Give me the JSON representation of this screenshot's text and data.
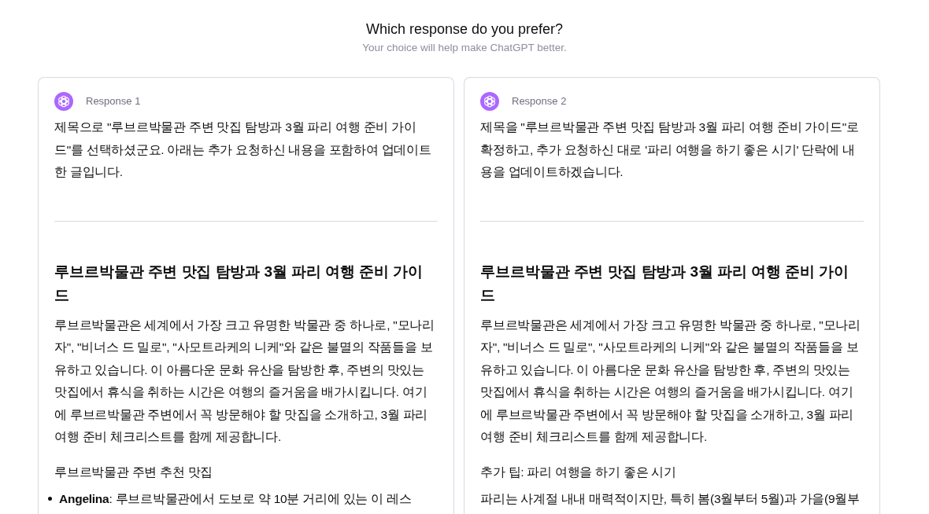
{
  "header": {
    "title": "Which response do you prefer?",
    "subtitle": "Your choice will help make ChatGPT better."
  },
  "responses": [
    {
      "label": "Response 1",
      "blocks": [
        {
          "kind": "paragraph",
          "text": "제목으로 \"루브르박물관 주변 맛집 탐방과 3월 파리 여행 준비 가이드\"를 선택하셨군요. 아래는 추가 요청하신 내용을 포함하여 업데이트한 글입니다."
        },
        {
          "kind": "rule"
        },
        {
          "kind": "heading",
          "text": "루브르박물관 주변 맛집 탐방과 3월 파리 여행 준비 가이드"
        },
        {
          "kind": "paragraph",
          "text": "루브르박물관은 세계에서 가장 크고 유명한 박물관 중 하나로, \"모나리자\", \"비너스 드 밀로\", \"사모트라케의 니케\"와 같은 불멸의 작품들을 보유하고 있습니다. 이 아름다운 문화 유산을 탐방한 후, 주변의 맛있는 맛집에서 휴식을 취하는 시간은 여행의 즐거움을 배가시킵니다. 여기에 루브르박물관 주변에서 꼭 방문해야 할 맛집을 소개하고, 3월 파리 여행 준비 체크리스트를 함께 제공합니다."
        },
        {
          "kind": "subheading",
          "text": "루브르박물관 주변 추천 맛집"
        },
        {
          "kind": "bullet",
          "text": "**Angelina**: 루브르박물관에서 도보로 약 10분 거리에 있는 이 레스"
        }
      ]
    },
    {
      "label": "Response 2",
      "blocks": [
        {
          "kind": "paragraph",
          "text": "제목을 \"루브르박물관 주변 맛집 탐방과 3월 파리 여행 준비 가이드\"로 확정하고, 추가 요청하신 대로 '파리 여행을 하기 좋은 시기' 단락에 내용을 업데이트하겠습니다."
        },
        {
          "kind": "rule"
        },
        {
          "kind": "heading",
          "text": "루브르박물관 주변 맛집 탐방과 3월 파리 여행 준비 가이드"
        },
        {
          "kind": "paragraph",
          "text": "루브르박물관은 세계에서 가장 크고 유명한 박물관 중 하나로, \"모나리자\", \"비너스 드 밀로\", \"사모트라케의 니케\"와 같은 불멸의 작품들을 보유하고 있습니다. 이 아름다운 문화 유산을 탐방한 후, 주변의 맛있는 맛집에서 휴식을 취하는 시간은 여행의 즐거움을 배가시킵니다. 여기에 루브르박물관 주변에서 꼭 방문해야 할 맛집을 소개하고, 3월 파리 여행 준비 체크리스트를 함께 제공합니다."
        },
        {
          "kind": "subheading",
          "text": "추가 팁: 파리 여행을 하기 좋은 시기"
        },
        {
          "kind": "paragraph",
          "text": "파리는 사계절 내내 매력적이지만, 특히 봄(3월부터 5월)과 가을(9월부"
        }
      ]
    }
  ]
}
